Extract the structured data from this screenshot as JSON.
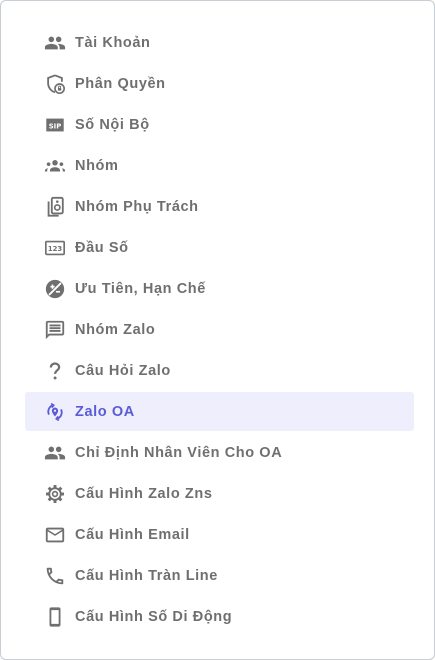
{
  "colors": {
    "text": "#6f6f6f",
    "active_text": "#5b5bd6",
    "active_background": "#eeeefd"
  },
  "menu": {
    "active_item": "zalo-oa",
    "items": [
      {
        "id": "tai-khoan",
        "label": "Tài Khoản",
        "icon": "people-icon"
      },
      {
        "id": "phan-quyen",
        "label": "Phân Quyền",
        "icon": "shield-lock-icon"
      },
      {
        "id": "so-noi-bo",
        "label": "Số Nội Bộ",
        "icon": "sip-icon"
      },
      {
        "id": "nhom",
        "label": "Nhóm",
        "icon": "groups-icon"
      },
      {
        "id": "nhom-phu-trach",
        "label": "Nhóm Phụ Trách",
        "icon": "speaker-group-icon"
      },
      {
        "id": "dau-so",
        "label": "Đầu Số",
        "icon": "number-123-icon"
      },
      {
        "id": "uu-tien-han-che",
        "label": "Ưu Tiên, Hạn Chế",
        "icon": "priority-icon"
      },
      {
        "id": "nhom-zalo",
        "label": "Nhóm Zalo",
        "icon": "message-icon"
      },
      {
        "id": "cau-hoi-zalo",
        "label": "Câu Hỏi Zalo",
        "icon": "question-mark-icon"
      },
      {
        "id": "zalo-oa",
        "label": "Zalo OA",
        "icon": "sync-location-icon"
      },
      {
        "id": "chi-dinh-nhan-vien",
        "label": "Chỉ Định Nhân Viên Cho OA",
        "icon": "people-icon"
      },
      {
        "id": "cau-hinh-zalo-zns",
        "label": "Cấu Hình Zalo Zns",
        "icon": "gear-icon"
      },
      {
        "id": "cau-hinh-email",
        "label": "Cấu Hình Email",
        "icon": "mail-icon"
      },
      {
        "id": "cau-hinh-tran-line",
        "label": "Cấu Hình Tràn Line",
        "icon": "phone-icon"
      },
      {
        "id": "cau-hinh-so-di-dong",
        "label": "Cấu Hình Số Di Động",
        "icon": "smartphone-icon"
      }
    ]
  }
}
